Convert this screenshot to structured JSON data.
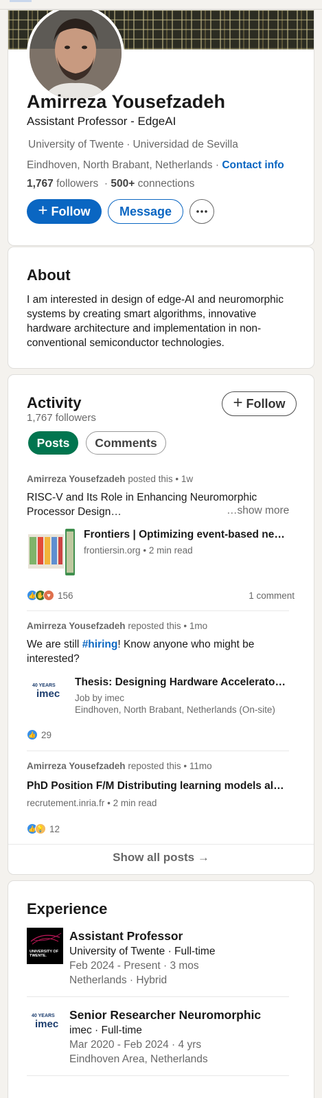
{
  "profile": {
    "name": "Amirreza Yousefzadeh",
    "headline": "Assistant Professor - EdgeAI",
    "education_1": "University of Twente",
    "education_2": "Universidad de Sevilla",
    "location": "Eindhoven, North Brabant, Netherlands",
    "contact_label": "Contact info",
    "followers_count": "1,767",
    "followers_label": "followers",
    "connections_count": "500+",
    "connections_label": "connections",
    "follow_label": "Follow",
    "message_label": "Message",
    "separator": "·"
  },
  "about": {
    "title": "About",
    "text": "I am interested in design of edge-AI and neuromorphic systems by creating smart algorithms, innovative hardware architecture and implementation in non-conventional semiconductor technologies."
  },
  "activity": {
    "title": "Activity",
    "followers": "1,767 followers",
    "follow_label": "Follow",
    "tabs": [
      "Posts",
      "Comments"
    ],
    "posts": [
      {
        "author": "Amirreza Yousefzadeh",
        "action": "posted this",
        "age": "1w",
        "text": "RISC-V and Its Role in Enhancing Neuromorphic Processor Design…",
        "show_more": "…show more",
        "link_title": "Frontiers | Optimizing event-based ne…",
        "link_source": "frontiersin.org",
        "link_read": "2 min read",
        "reactions": "156",
        "comments": "1 comment"
      },
      {
        "author": "Amirreza Yousefzadeh",
        "action": "reposted this",
        "age": "1mo",
        "text_prefix": "We are still ",
        "hashtag": "#hiring",
        "text_suffix": "! Know anyone who might be interested?",
        "link_title": "Thesis: Designing Hardware Accelerator…",
        "job_by": "Job by imec",
        "job_location": "Eindhoven, North Brabant, Netherlands (On-site)",
        "reactions": "29"
      },
      {
        "author": "Amirreza Yousefzadeh",
        "action": "reposted this",
        "age": "11mo",
        "link_title": "PhD Position F/M Distributing learning models alo…",
        "link_source": "recrutement.inria.fr",
        "link_read": "2 min read",
        "reactions": "12"
      }
    ],
    "show_all": "Show all posts →"
  },
  "experience": {
    "title": "Experience",
    "items": [
      {
        "title": "Assistant Professor",
        "company": "University of Twente · Full-time",
        "dates": "Feb 2024 - Present · 3 mos",
        "location": "Netherlands · Hybrid",
        "logo_text": "UNIVERSITY OF TWENTE."
      },
      {
        "title": "Senior Researcher Neuromorphic",
        "company": "imec · Full-time",
        "dates": "Mar 2020 - Feb 2024 · 4 yrs",
        "location": "Eindhoven Area, Netherlands",
        "logo_text": "imec"
      }
    ]
  },
  "logos": {
    "imec_years": "40 YEARS",
    "imec_name": "imec"
  },
  "colors": {
    "brand_blue": "#0a66c2",
    "posts_green": "#01754f"
  }
}
